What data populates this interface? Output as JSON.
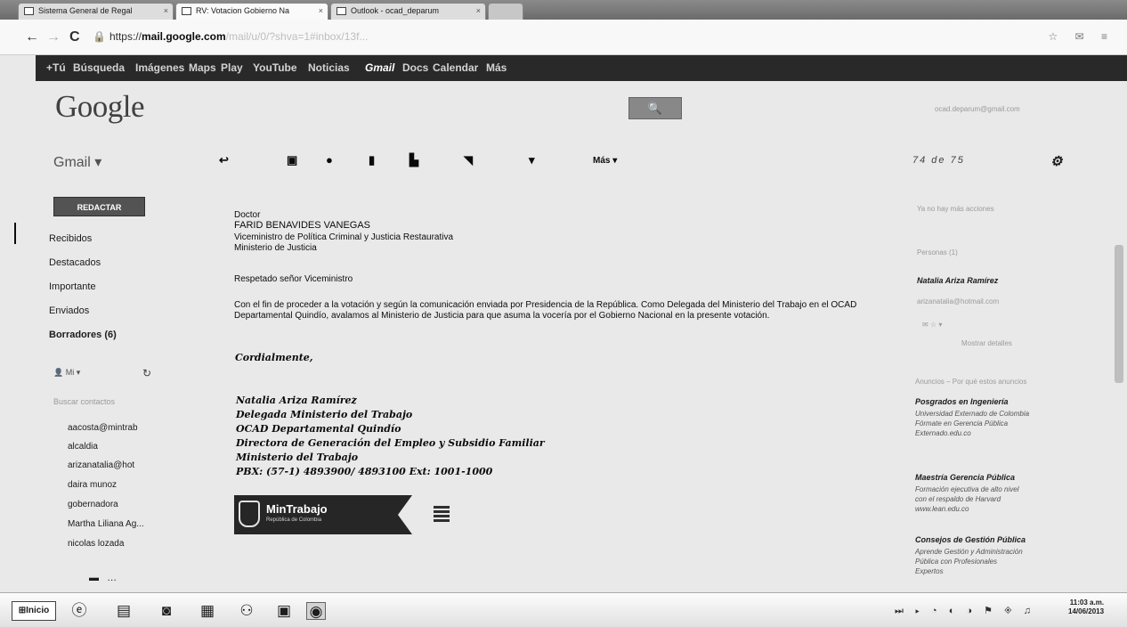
{
  "browser": {
    "tabs": [
      {
        "title": "Sistema General de Regal"
      },
      {
        "title": "RV: Votacion Gobierno Na"
      },
      {
        "title": "Outlook - ocad_deparum"
      }
    ],
    "url_host": "mail.google.com",
    "url_scheme": "https://",
    "url_path": "/mail/u/0/?shva=1#inbox/13f..."
  },
  "gbar": {
    "items": [
      "+Tú",
      "Búsqueda",
      "Imágenes",
      "Maps",
      "Play",
      "YouTube",
      "Noticias",
      "Gmail",
      "Docs",
      "Calendar",
      "Más"
    ]
  },
  "header": {
    "logo": "Google",
    "account": "ocad.deparum@gmail.com"
  },
  "toolbar": {
    "gmail_label": "Gmail ▾",
    "pager": "74 de 75",
    "more_label": "Más ▾"
  },
  "sidebar": {
    "compose": "REDACTAR",
    "nav": [
      "Recibidos",
      "Destacados",
      "Importante",
      "Enviados",
      "Borradores (6)"
    ],
    "chat_status": "Mi ▾",
    "contact_search": "Buscar contactos",
    "contacts": [
      "aacosta@mintrab",
      "alcaldia",
      "arizanatalia@hot",
      "daira munoz",
      "gobernadora",
      "Martha Liliana Ag...",
      "nicolas lozada"
    ]
  },
  "message": {
    "salutation_title": "Doctor",
    "recipient_name": "FARID BENAVIDES VANEGAS",
    "recipient_role": "Viceministro de Política Criminal y Justicia Restaurativa",
    "recipient_org": "Ministerio de Justicia",
    "greeting": "Respetado señor Viceministro",
    "body": "Con el fin de proceder a la votación y según la comunicación enviada por Presidencia de la República. Como Delegada del Ministerio del Trabajo en el OCAD Departamental Quindío, avalamos al Ministerio de Justicia para que asuma la vocería por el Gobierno Nacional en la presente votación.",
    "closing": "Cordialmente,",
    "signature": [
      "Natalia Ariza Ramírez",
      "Delegada Ministerio del Trabajo",
      "OCAD Departamental Quindío",
      "Directora de Generación del Empleo y Subsidio Familiar",
      "Ministerio del Trabajo",
      "PBX: (57-1) 4893900/ 4893100 Ext: 1001-1000"
    ],
    "logo_text": "MinTrabajo",
    "logo_sub": "República de Colombia"
  },
  "right_panel": {
    "top_note": "Ya no hay más acciones",
    "people_header": "Personas (1)",
    "person_name": "Natalia Ariza Ramírez",
    "person_email": "arizanatalia@hotmail.com",
    "person_link": "Mostrar detalles",
    "ads_header": "Anuncios – Por qué estos anuncios",
    "ads": [
      {
        "title": "Posgrados en Ingeniería",
        "lines": [
          "Universidad Externado de Colombia",
          "Fórmate en Gerencia Pública",
          "Externado.edu.co"
        ]
      },
      {
        "title": "Maestría Gerencia Pública",
        "lines": [
          "Formación ejecutiva de alto nivel",
          "con el respaldo de Harvard",
          "www.lean.edu.co"
        ]
      },
      {
        "title": "Consejos de Gestión Pública",
        "lines": [
          "Aprende Gestión y Administración",
          "Pública con Profesionales",
          "Expertos"
        ]
      }
    ]
  },
  "taskbar": {
    "start": "Inicio",
    "time": "11:03 a.m.",
    "date": "14/06/2013"
  }
}
